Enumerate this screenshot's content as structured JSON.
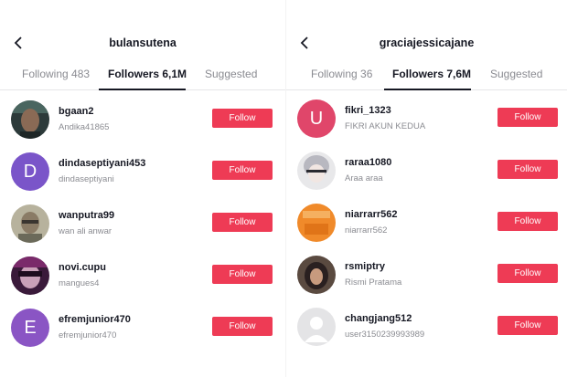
{
  "left": {
    "title": "bulansutena",
    "tabs": [
      "Following 483",
      "Followers 6,1M",
      "Suggested"
    ],
    "users": [
      {
        "username": "bgaan2",
        "display": "Andika41865",
        "follow": "Follow",
        "avatar": "photo-dark-portrait"
      },
      {
        "username": "dindaseptiyani453",
        "display": "dindaseptiyani",
        "follow": "Follow",
        "avatar": "D",
        "avatar_color": "#7a55c9"
      },
      {
        "username": "wanputra99",
        "display": "wan ali anwar",
        "follow": "Follow",
        "avatar": "photo-man-glasses"
      },
      {
        "username": "novi.cupu",
        "display": "mangues4",
        "follow": "Follow",
        "avatar": "photo-purple-girl"
      },
      {
        "username": "efremjunior470",
        "display": "efremjunior470",
        "follow": "Follow",
        "avatar": "E",
        "avatar_color": "#8a55c4"
      }
    ]
  },
  "right": {
    "title": "graciajessicajane",
    "tabs": [
      "Following 36",
      "Followers 7,6M",
      "Suggested"
    ],
    "users": [
      {
        "username": "fikri_1323",
        "display": "FIKRI AKUN KEDUA",
        "follow": "Follow",
        "avatar": "U",
        "avatar_color": "#e0466a"
      },
      {
        "username": "raraa1080",
        "display": "Araa araa",
        "follow": "Follow",
        "avatar": "photo-grey-hair"
      },
      {
        "username": "niarrarr562",
        "display": "niarrarr562",
        "follow": "Follow",
        "avatar": "photo-orange"
      },
      {
        "username": "rsmiptry",
        "display": "Rismi Pratama",
        "follow": "Follow",
        "avatar": "photo-hijab"
      },
      {
        "username": "changjang512",
        "display": "user3150239993989",
        "follow": "Follow",
        "avatar": "default-person"
      }
    ]
  },
  "colors": {
    "accent": "#ee3b55",
    "text": "#161823",
    "muted": "#8a8b91"
  }
}
